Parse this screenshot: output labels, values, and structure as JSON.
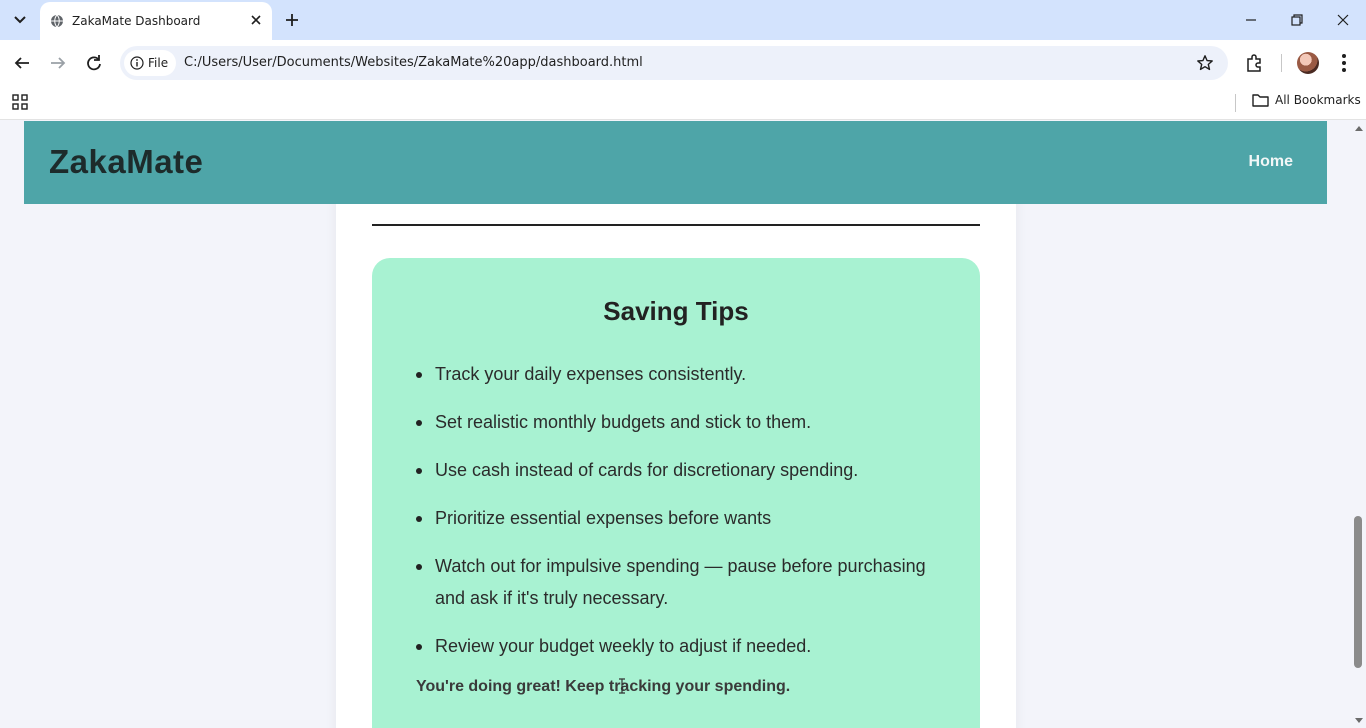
{
  "browser": {
    "tab_title": "ZakaMate Dashboard",
    "site_chip": "File",
    "url": "C:/Users/User/Documents/Websites/ZakaMate%20app/dashboard.html",
    "bookmarks_label": "All Bookmarks"
  },
  "header": {
    "brand": "ZakaMate",
    "nav_home": "Home"
  },
  "saving_tips": {
    "title": "Saving Tips",
    "items": [
      "Track your daily expenses consistently.",
      "Set realistic monthly budgets and stick to them.",
      "Use cash instead of cards for discretionary spending.",
      "Prioritize essential expenses before wants",
      "Watch out for impulsive spending — pause before purchasing and ask if it's truly necessary.",
      "Review your budget weekly to adjust if needed."
    ],
    "encouragement": "You're doing great! Keep tracking your spending."
  },
  "colors": {
    "header_bg": "#4ea5a8",
    "tips_bg": "#a8f2d2",
    "tabbar_bg": "#d3e3fd"
  },
  "icons": [
    "tab-list-icon",
    "globe-icon",
    "close-icon",
    "plus-icon",
    "minimize-icon",
    "restore-icon",
    "back-icon",
    "forward-icon",
    "reload-icon",
    "info-icon",
    "star-icon",
    "extensions-icon",
    "more-vert-icon",
    "apps-icon",
    "folder-icon"
  ]
}
